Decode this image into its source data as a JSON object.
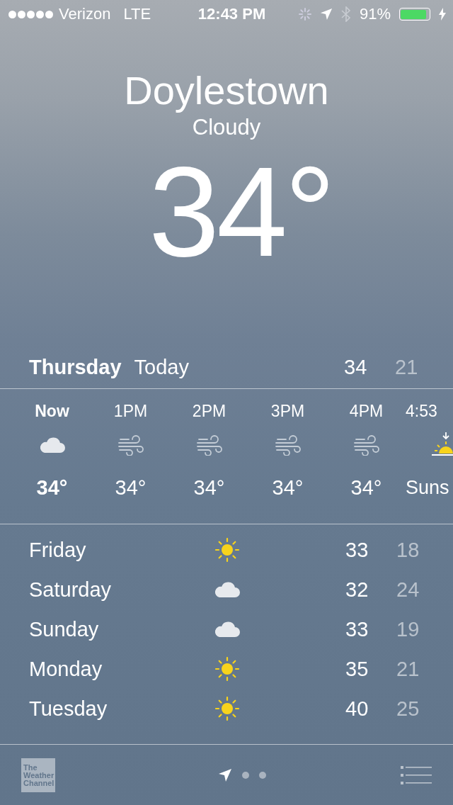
{
  "status_bar": {
    "carrier": "Verizon",
    "network": "LTE",
    "time": "12:43 PM",
    "battery_percent": "91%"
  },
  "location": {
    "city": "Doylestown",
    "condition": "Cloudy",
    "temperature": "34°"
  },
  "today": {
    "day": "Thursday",
    "label": "Today",
    "high": "34",
    "low": "21"
  },
  "hourly": [
    {
      "time": "Now",
      "kind": "cloud",
      "value": "34°",
      "now": true
    },
    {
      "time": "1PM",
      "kind": "wind",
      "value": "34°",
      "now": false
    },
    {
      "time": "2PM",
      "kind": "wind",
      "value": "34°",
      "now": false
    },
    {
      "time": "3PM",
      "kind": "wind",
      "value": "34°",
      "now": false
    },
    {
      "time": "4PM",
      "kind": "wind",
      "value": "34°",
      "now": false
    },
    {
      "time": "4:53",
      "kind": "sunset",
      "value": "Suns",
      "now": false
    }
  ],
  "daily": [
    {
      "day": "Friday",
      "kind": "sun",
      "high": "33",
      "low": "18"
    },
    {
      "day": "Saturday",
      "kind": "cloud",
      "high": "32",
      "low": "24"
    },
    {
      "day": "Sunday",
      "kind": "cloud",
      "high": "33",
      "low": "19"
    },
    {
      "day": "Monday",
      "kind": "sun",
      "high": "35",
      "low": "21"
    },
    {
      "day": "Tuesday",
      "kind": "sun",
      "high": "40",
      "low": "25"
    }
  ],
  "bottom_bar": {
    "logo": [
      "The",
      "Weather",
      "Channel"
    ],
    "pages": [
      {
        "kind": "location",
        "selected": true
      },
      {
        "kind": "dot",
        "selected": false
      },
      {
        "kind": "dot",
        "selected": false
      }
    ]
  }
}
